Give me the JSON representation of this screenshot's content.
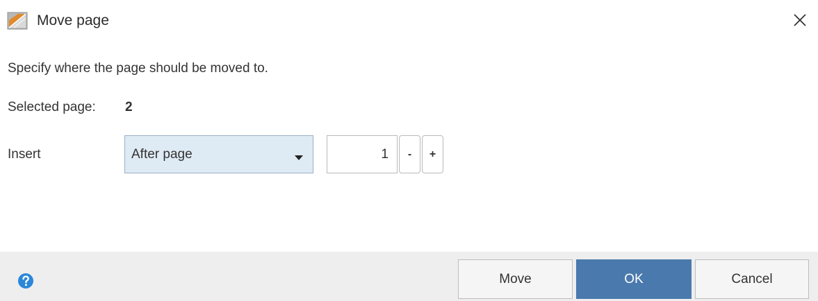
{
  "window": {
    "title": "Move page",
    "app_icon": "move-page-icon",
    "close_icon": "close-icon"
  },
  "content": {
    "instruction": "Specify where the page should be moved to.",
    "selected_page_label": "Selected page:",
    "selected_page_value": "2",
    "insert_label": "Insert",
    "position_dropdown": {
      "selected": "After page"
    },
    "page_number": {
      "value": "1",
      "decrement_label": "-",
      "increment_label": "+"
    }
  },
  "footer": {
    "help_icon": "help-icon",
    "move_label": "Move",
    "ok_label": "OK",
    "cancel_label": "Cancel"
  },
  "colors": {
    "primary_button": "#4a79ad",
    "dropdown_background": "#deeaf4",
    "footer_background": "#eeeeee",
    "help_icon": "#2b87d8"
  }
}
